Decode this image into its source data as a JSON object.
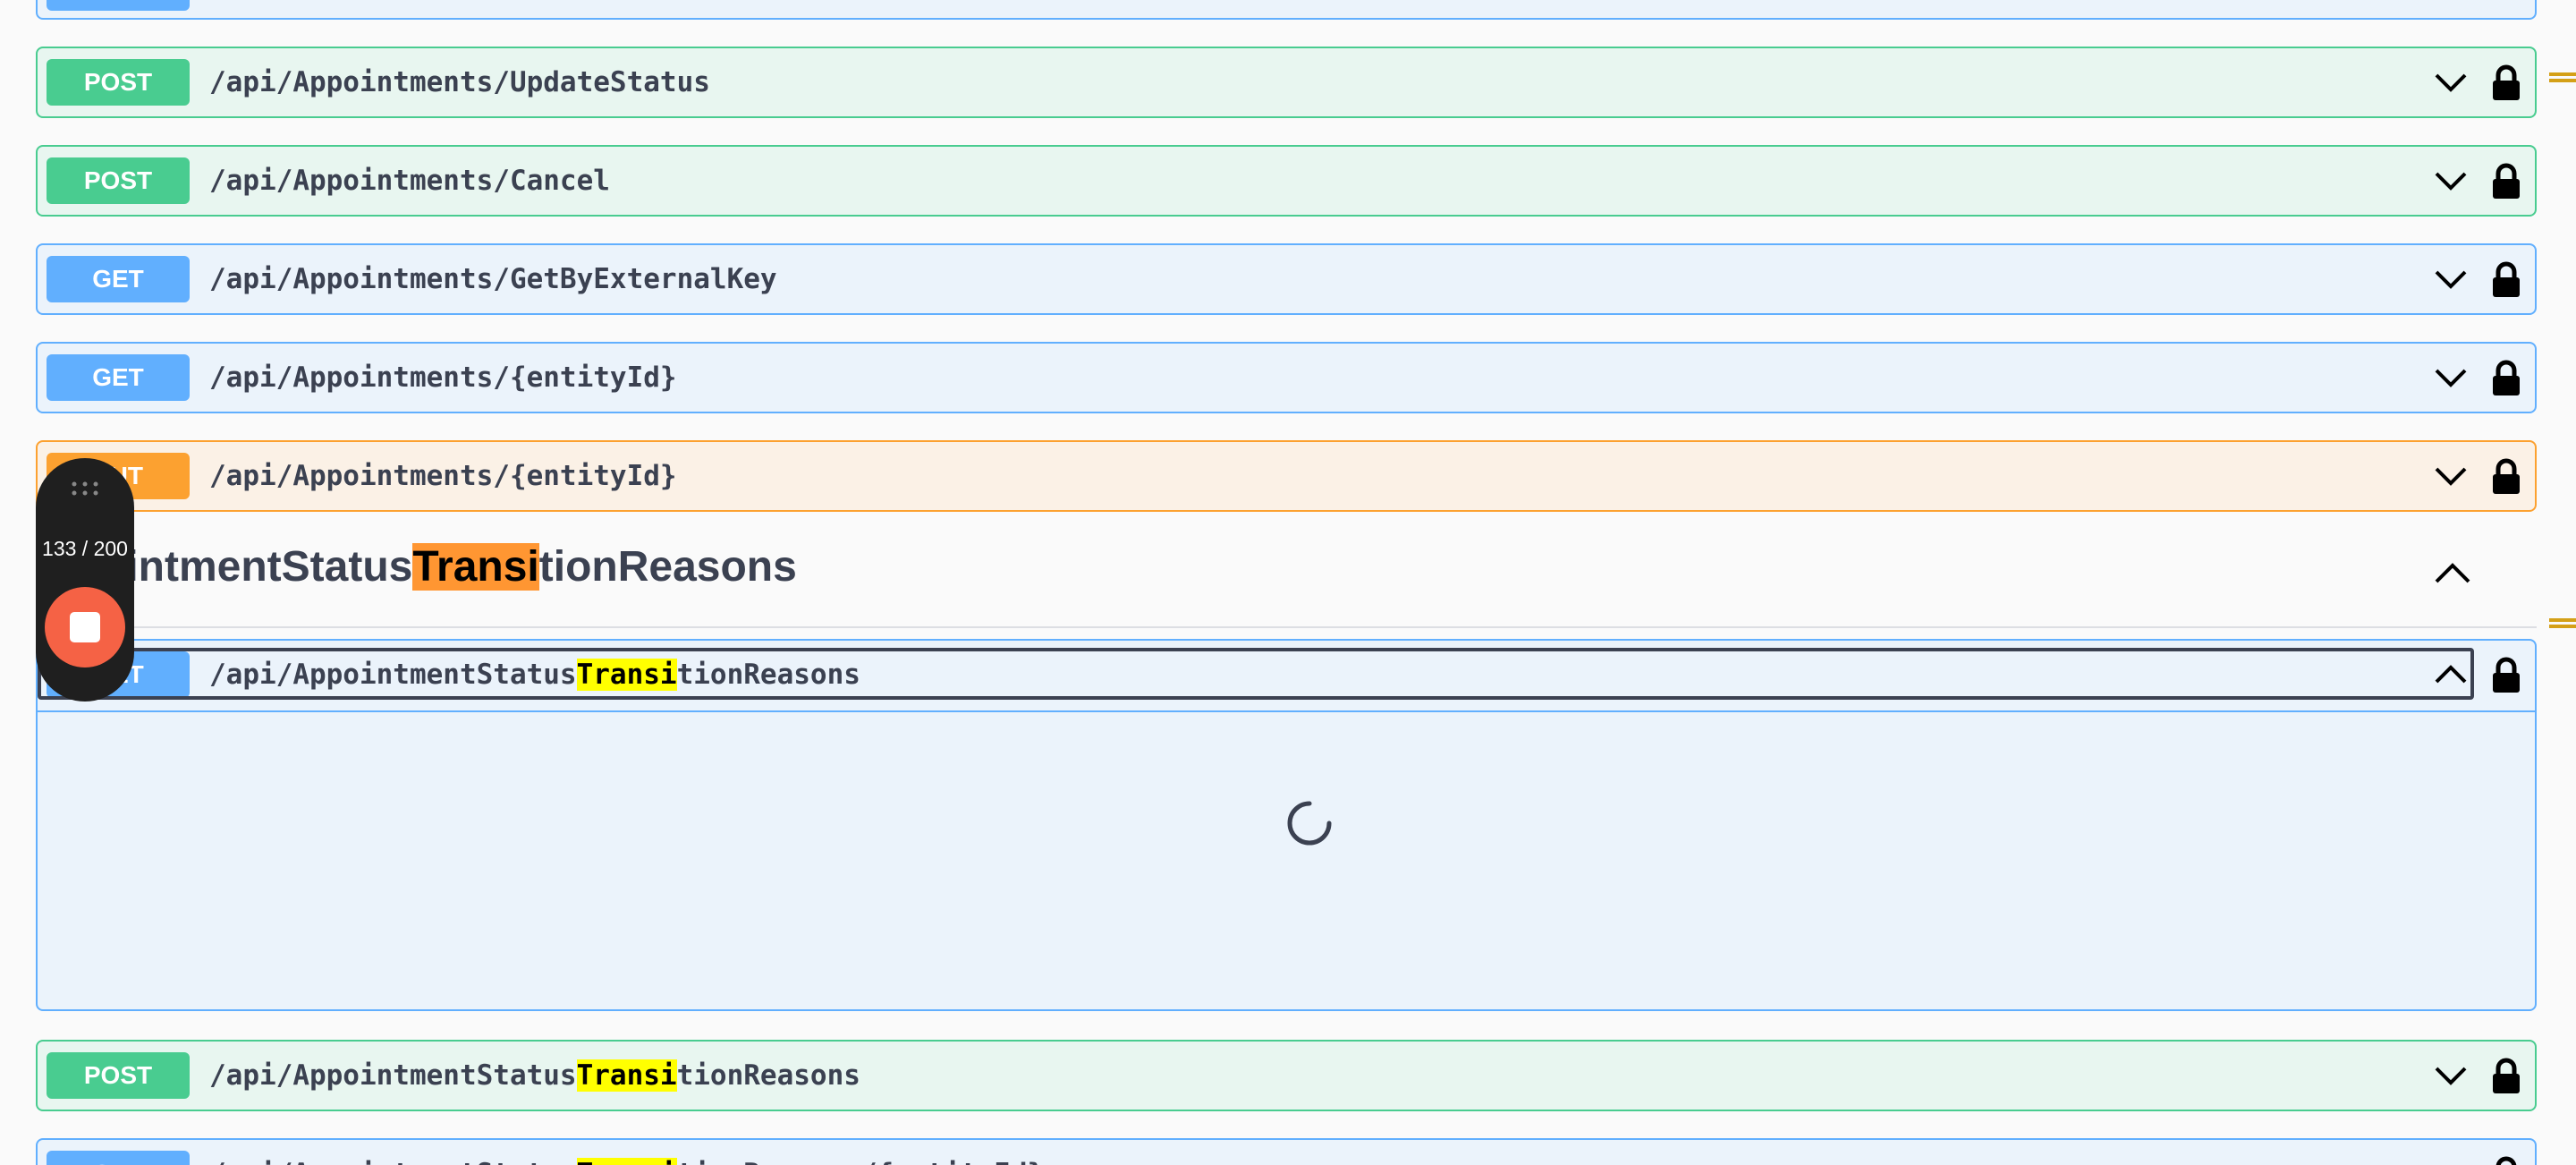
{
  "operations": [
    {
      "method": "POST",
      "path": "/api/Appointments/UpdateStatus"
    },
    {
      "method": "POST",
      "path": "/api/Appointments/Cancel"
    },
    {
      "method": "GET",
      "path": "/api/Appointments/GetByExternalKey"
    },
    {
      "method": "GET",
      "path": "/api/Appointments/{entityId}"
    },
    {
      "method": "PUT",
      "path": "/api/Appointments/{entityId}"
    }
  ],
  "tag": {
    "name_prefix": "ointmentStatus",
    "name_match": "Transi",
    "name_suffix": "tionReasons"
  },
  "expanded_op": {
    "method": "GET",
    "path_prefix": "/api/AppointmentStatus",
    "path_match": "Transi",
    "path_suffix": "tionReasons"
  },
  "post_op": {
    "method": "POST",
    "path_prefix": "/api/AppointmentStatus",
    "path_match": "Transi",
    "path_suffix": "tionReasons"
  },
  "partial_op": {
    "method": "GET",
    "path_prefix": "/api/AppointmentStatus",
    "path_match": "Transi",
    "path_suffix": "tionReasons/{entityId}"
  },
  "recorder": {
    "counter": "133 / 200"
  },
  "colors": {
    "get": "#61affe",
    "post": "#49cc90",
    "put": "#fca130",
    "find_current": "#ff9632",
    "find_match": "#ffff00",
    "stop": "#f56245"
  },
  "icons": {
    "collapsed": "chevron-down-icon",
    "expanded": "chevron-up-icon",
    "auth": "lock-icon",
    "loading": "spinner-icon",
    "drag": "grip-icon"
  }
}
